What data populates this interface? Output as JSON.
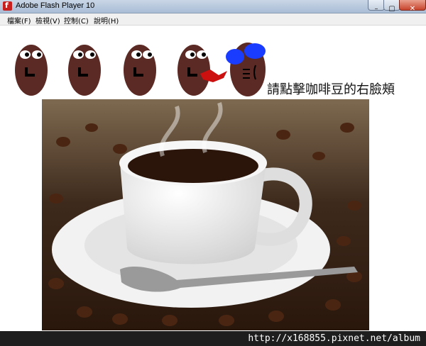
{
  "window": {
    "title": "Adobe Flash Player 10",
    "icon": "flash-app-icon",
    "controls": {
      "minimize": "–",
      "maximize": "▢",
      "close": "✕"
    }
  },
  "menu": {
    "items": [
      {
        "label": "檔案(F)"
      },
      {
        "label": "檢視(V)"
      },
      {
        "label": "控制(C)"
      },
      {
        "label": "說明(H)"
      }
    ]
  },
  "stage": {
    "instruction": "請點擊咖啡豆的右臉頰",
    "bean_color": "#5c2a24",
    "hit_color": "#cc1010",
    "face_color": "#1a3cff",
    "photo_subject": "coffee cup on saucer with spoon over coffee beans"
  },
  "watermark": {
    "text": "http://x168855.pixnet.net/album"
  }
}
